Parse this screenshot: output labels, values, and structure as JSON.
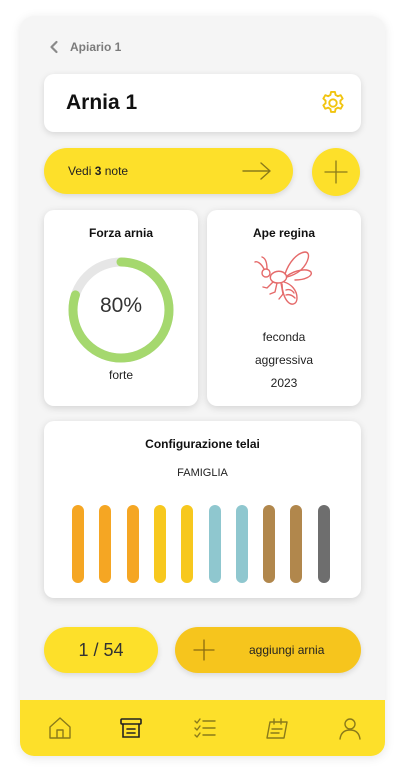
{
  "header": {
    "back_label": "Apiario 1"
  },
  "hive": {
    "title": "Arnia 1"
  },
  "notes": {
    "prefix": "Vedi",
    "count": "3",
    "suffix": "note"
  },
  "strength": {
    "title": "Forza arnia",
    "percent_label": "80%",
    "value": 0.8,
    "status": "forte",
    "ring_color": "#a5d86e",
    "track_color": "#e6e6e6"
  },
  "queen": {
    "title": "Ape regina",
    "lines": [
      "feconda",
      "aggressiva",
      "2023"
    ],
    "icon": "bee-icon",
    "icon_color": "#e56a6a"
  },
  "frames": {
    "title": "Configurazione telai",
    "subtitle": "FAMIGLIA",
    "colors": [
      "#f5a623",
      "#f5a623",
      "#f5a623",
      "#f7c81e",
      "#f7c81e",
      "#8fc7cf",
      "#8fc7cf",
      "#b1874c",
      "#b1874c",
      "#6e6e6e"
    ]
  },
  "footer": {
    "counter": "1 / 54",
    "add_label": "aggiungi arnia"
  },
  "colors": {
    "accent": "#fde02a",
    "accent_dark": "#f6c51d",
    "gear": "#f1c40f"
  },
  "nav": {
    "items": [
      "home-icon",
      "archive-icon",
      "checklist-icon",
      "calendar-icon",
      "user-icon"
    ]
  }
}
